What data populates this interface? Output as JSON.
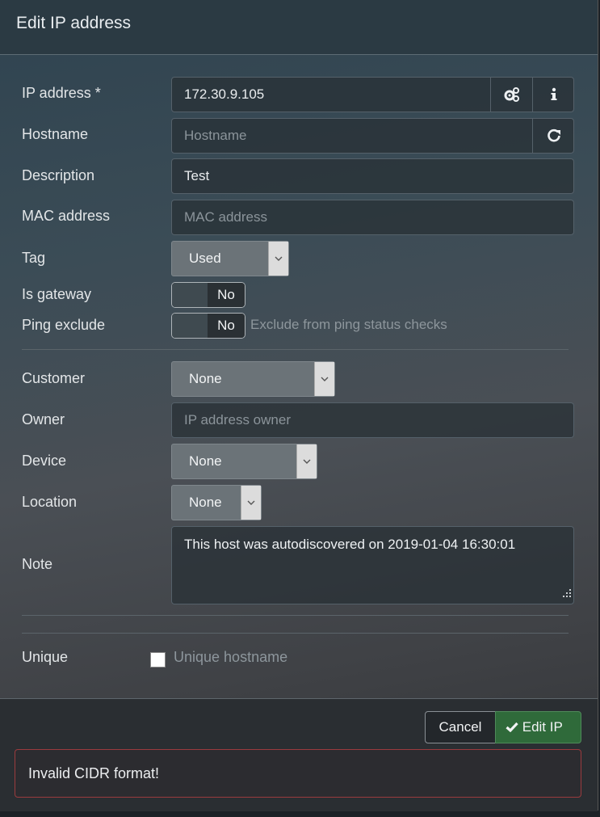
{
  "title": "Edit IP address",
  "fields": {
    "ip": {
      "label": "IP address *",
      "value": "172.30.9.105"
    },
    "hostname": {
      "label": "Hostname",
      "placeholder": "Hostname"
    },
    "description": {
      "label": "Description",
      "value": "Test"
    },
    "mac": {
      "label": "MAC address",
      "placeholder": "MAC address"
    },
    "tag": {
      "label": "Tag",
      "value": "Used"
    },
    "is_gateway": {
      "label": "Is gateway",
      "value": "No"
    },
    "ping_exclude": {
      "label": "Ping exclude",
      "value": "No",
      "hint": "Exclude from ping status checks"
    },
    "customer": {
      "label": "Customer",
      "value": "None"
    },
    "owner": {
      "label": "Owner",
      "placeholder": "IP address owner"
    },
    "device": {
      "label": "Device",
      "value": "None"
    },
    "location": {
      "label": "Location",
      "value": "None"
    },
    "note": {
      "label": "Note",
      "value": "This host was autodiscovered on 2019-01-04 16:30:01"
    },
    "unique": {
      "label": "Unique",
      "checkbox_label": "Unique hostname",
      "checked": false
    }
  },
  "buttons": {
    "cancel": "Cancel",
    "edit": "Edit IP"
  },
  "alert": "Invalid CIDR format!",
  "icons": [
    "gears-icon",
    "info-icon",
    "refresh-icon",
    "chevron-down-icon",
    "check-icon",
    "resize-handle-icon"
  ],
  "colors": {
    "edit_button": "#2f6a3a",
    "alert_border": "#9b3b3e"
  }
}
